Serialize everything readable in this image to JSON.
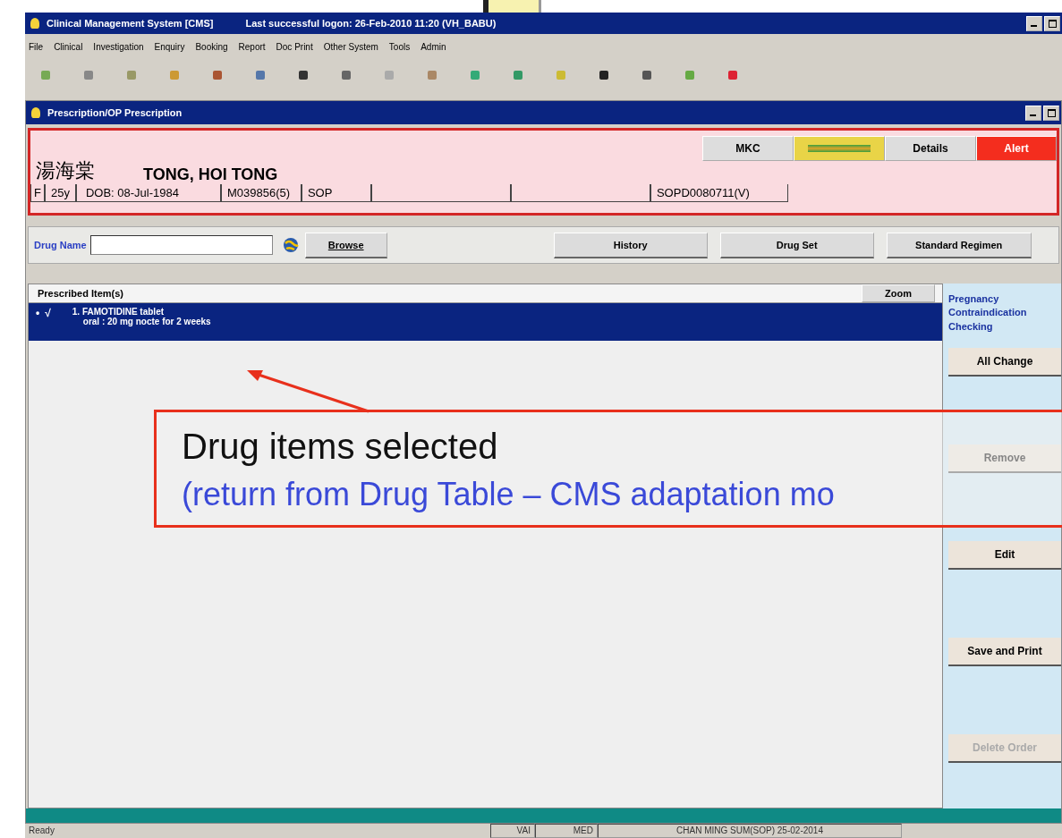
{
  "app_window": {
    "title": "Clinical Management System [CMS]",
    "last_login": "Last successful logon: 26-Feb-2010 11:20 (VH_BABU)"
  },
  "menu": [
    "File",
    "Clinical",
    "Investigation",
    "Enquiry",
    "Booking",
    "Report",
    "Doc Print",
    "Other System",
    "Tools",
    "Admin"
  ],
  "prescription_window": {
    "title": "Prescription/OP Prescription"
  },
  "patient": {
    "name_chinese": "湯海棠",
    "name": "TONG, HOI TONG",
    "fields": [
      "F",
      "25y",
      "DOB: 08-Jul-1984",
      "M039856(5)",
      "SOP",
      "SOPD0080711(V)"
    ]
  },
  "header_buttons": [
    {
      "kind": "plain",
      "label": "MKC"
    },
    {
      "kind": "banner"
    },
    {
      "kind": "plain",
      "label": "Details"
    },
    {
      "kind": "alert",
      "label": "Alert"
    }
  ],
  "drug_search": {
    "label": "Drug Name",
    "browse": "Browse"
  },
  "buttons": [
    "History",
    "Drug Set",
    "Standard Regimen"
  ],
  "prescribed": {
    "heading": "Prescribed Item(s)",
    "zoom": "Zoom",
    "items": [
      {
        "selected": true,
        "bullet": "•",
        "tick": "√",
        "line1": "1. FAMOTIDINE tablet",
        "line2": "oral : 20 mg nocte for 2 weeks"
      }
    ]
  },
  "side_panel": {
    "heading": "Pregnancy Contraindication Checking",
    "buttons": [
      {
        "label": "All Change",
        "disabled": false
      },
      {
        "label": "Remove",
        "disabled": false
      },
      {
        "label": "Edit",
        "disabled": false
      },
      {
        "label": "Save and Print",
        "disabled": false
      },
      {
        "label": "Delete Order",
        "disabled": true
      }
    ]
  },
  "status_bar": [
    "Ready",
    "VAI",
    "MED",
    "CHAN MING SUM(SOP) 25-02-2014"
  ],
  "callout": {
    "title": "Drug items selected",
    "subtitle": "(return from Drug Table – CMS adaptation mo"
  }
}
